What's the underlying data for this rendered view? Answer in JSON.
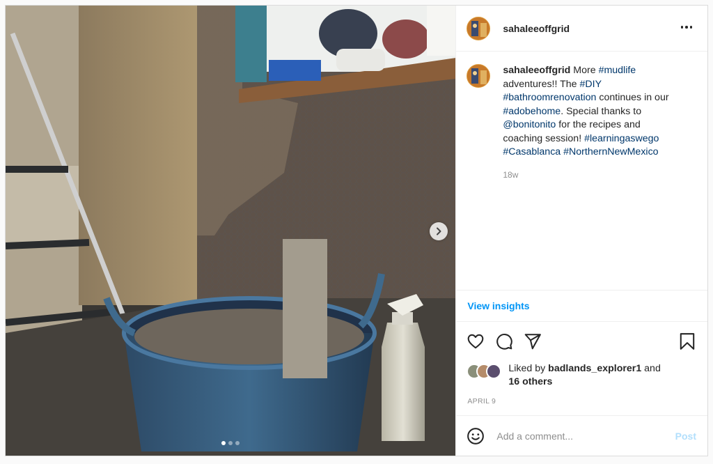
{
  "post": {
    "username": "sahaleeoffgrid",
    "more_icon": "more-horizontal-icon",
    "media": {
      "carousel_count": 3,
      "active_index": 0,
      "next_icon": "chevron-right-icon"
    },
    "caption": {
      "username": "sahaleeoffgrid",
      "parts": [
        {
          "t": "text",
          "v": " More "
        },
        {
          "t": "tag",
          "v": "#mudlife"
        },
        {
          "t": "text",
          "v": " adventures!! The "
        },
        {
          "t": "tag",
          "v": "#DIY"
        },
        {
          "t": "text",
          "v": " "
        },
        {
          "t": "tag",
          "v": "#bathroomrenovation"
        },
        {
          "t": "text",
          "v": " continues in our "
        },
        {
          "t": "tag",
          "v": "#adobehome"
        },
        {
          "t": "text",
          "v": ". Special thanks to "
        },
        {
          "t": "tag",
          "v": "@bonitonito"
        },
        {
          "t": "text",
          "v": " for the recipes and coaching session! "
        },
        {
          "t": "tag",
          "v": "#learningaswego"
        },
        {
          "t": "text",
          "v": " "
        },
        {
          "t": "tag",
          "v": "#Casablanca"
        },
        {
          "t": "text",
          "v": " "
        },
        {
          "t": "tag",
          "v": "#NorthernNewMexico"
        }
      ],
      "age": "18w"
    },
    "insights_label": "View insights",
    "actions": {
      "like_icon": "heart-icon",
      "comment_icon": "comment-icon",
      "share_icon": "share-icon",
      "save_icon": "bookmark-icon"
    },
    "likes": {
      "prefix": "Liked by ",
      "user": "badlands_explorer1",
      "middle": " and",
      "others": "16 others"
    },
    "date": "APRIL 9",
    "comment": {
      "emoji_icon": "emoji-icon",
      "placeholder": "Add a comment...",
      "value": "",
      "post_label": "Post"
    },
    "colors": {
      "link": "#00376b",
      "accent": "#0095f6",
      "post_disabled": "#b2dffc"
    }
  }
}
